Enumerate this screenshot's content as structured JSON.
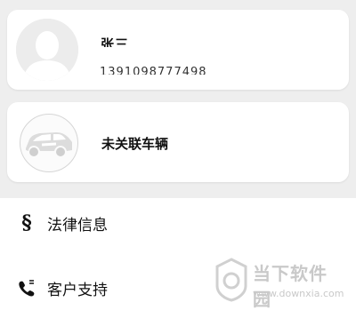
{
  "user_card": {
    "name": "张三",
    "phone": "1391098777498",
    "avatar_icon": "default-avatar-icon"
  },
  "vehicle_card": {
    "label": "未关联车辆",
    "icon": "car-icon"
  },
  "menu": {
    "items": [
      {
        "label": "法律信息",
        "icon": "section-sign-icon",
        "glyph": "§"
      },
      {
        "label": "客户支持",
        "icon": "phone-icon"
      }
    ]
  },
  "watermark": {
    "brand": "当下软件园",
    "url": "www.downxia.com"
  },
  "colors": {
    "background": "#eeeeee",
    "card": "#ffffff",
    "text": "#111111",
    "watermark": "#c9c9c9"
  }
}
